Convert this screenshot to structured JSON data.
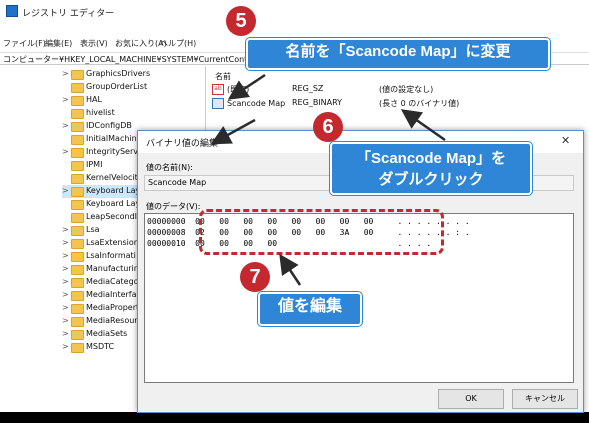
{
  "window": {
    "title": "レジストリ エディター"
  },
  "menu": [
    "ファイル(F)",
    "編集(E)",
    "表示(V)",
    "お気に入り(A)",
    "ヘルプ(H)"
  ],
  "address": "コンピューター¥HKEY_LOCAL_MACHINE¥SYSTEM¥CurrentControlSe",
  "tree": [
    "GraphicsDrivers",
    "GroupOrderList",
    "HAL",
    "hivelist",
    "IDConfigDB",
    "InitialMachine",
    "IntegrityServic",
    "IPMI",
    "KernelVelocity",
    "Keyboard Lay",
    "Keyboard Layo",
    "LeapSecondIn",
    "Lsa",
    "LsaExtensionC",
    "LsaInformati",
    "Manufacturing",
    "MediaCategor",
    "MediaInterfac",
    "MediaPropert",
    "MediaResourc",
    "MediaSets",
    "MSDTC"
  ],
  "values": {
    "header": "名前",
    "rows": [
      {
        "name": "(既定)",
        "type": "REG_SZ",
        "data": "(値の設定なし)"
      },
      {
        "name": "Scancode Map",
        "type": "REG_BINARY",
        "data": "(長さ 0 のバイナリ値)"
      }
    ]
  },
  "dialog": {
    "title": "バイナリ値の編集",
    "name_label": "値の名前(N):",
    "name_value": "Scancode Map",
    "data_label": "値のデータ(V):",
    "hex_lines": [
      "00000000  00   00   00   00   00   00   00   00     . . . . . . . .",
      "00000008  02   00   00   00   00   00   3A   00     . . . . . . : .",
      "00000010  00   00   00   00                         . . . ."
    ],
    "ok": "OK",
    "cancel": "キャンセル"
  },
  "annotations": {
    "step5": {
      "num": "5",
      "text": "名前を「Scancode Map」に変更"
    },
    "step6": {
      "num": "6",
      "line1": "「Scancode Map」を",
      "line2": "ダブルクリック"
    },
    "step7": {
      "num": "7",
      "text": "値を編集"
    }
  },
  "colors": {
    "callout": "#2f86d6",
    "badge": "#c6282f",
    "dashed": "#c6282f"
  }
}
